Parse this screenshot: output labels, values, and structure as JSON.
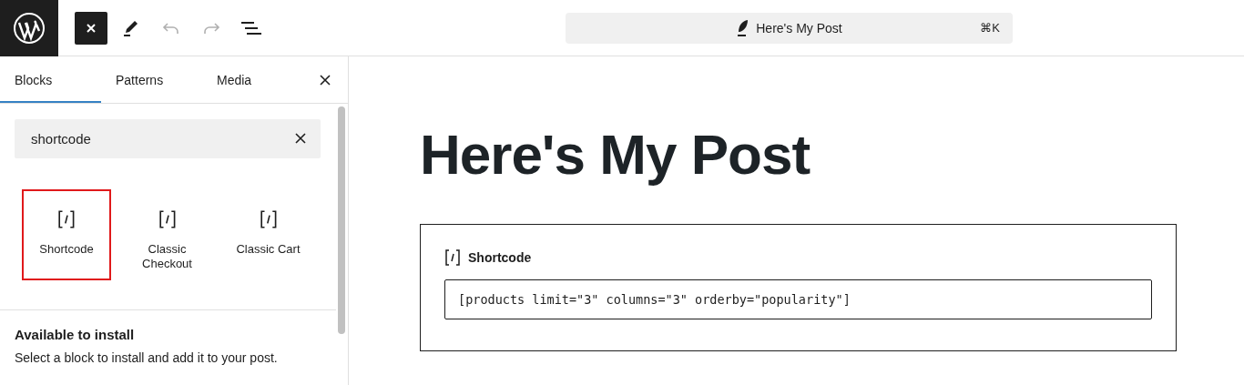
{
  "toolbar": {
    "buttons": [
      {
        "kind": "close",
        "active": true,
        "disabled": false
      },
      {
        "kind": "pencil",
        "active": false,
        "disabled": false
      },
      {
        "kind": "undo",
        "active": false,
        "disabled": true
      },
      {
        "kind": "redo",
        "active": false,
        "disabled": true
      },
      {
        "kind": "outline",
        "active": false,
        "disabled": false
      }
    ]
  },
  "command_bar": {
    "title": "Here's My Post",
    "shortcut": "⌘K"
  },
  "inserter": {
    "tabs": [
      {
        "label": "Blocks",
        "selected": true
      },
      {
        "label": "Patterns",
        "selected": false
      },
      {
        "label": "Media",
        "selected": false
      }
    ],
    "search": {
      "value": "shortcode"
    },
    "blocks": [
      {
        "label": "Shortcode",
        "selected": true
      },
      {
        "label": "Classic Checkout",
        "selected": false
      },
      {
        "label": "Classic Cart",
        "selected": false
      }
    ],
    "install": {
      "heading": "Available to install",
      "text": "Select a block to install and add it to your post."
    }
  },
  "editor": {
    "title": "Here's My Post",
    "block": {
      "label": "Shortcode",
      "value": "[products limit=\"3\" columns=\"3\" orderby=\"popularity\"]"
    }
  }
}
